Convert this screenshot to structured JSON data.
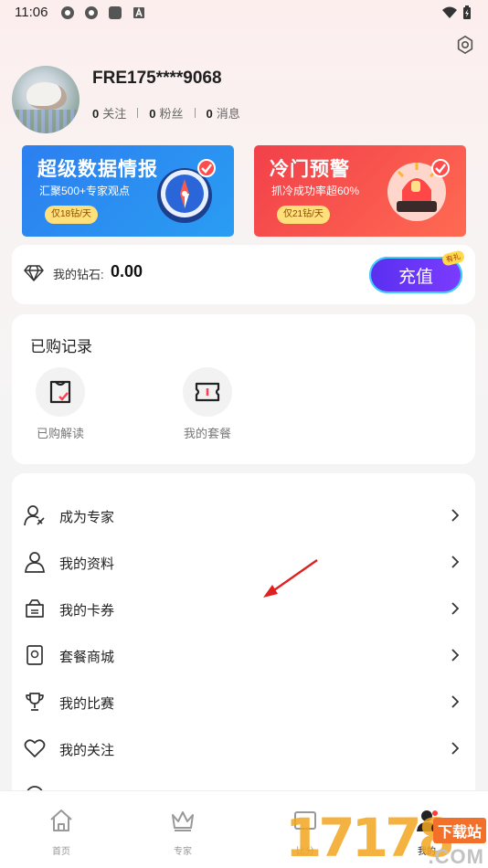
{
  "status_bar": {
    "time": "11:06"
  },
  "profile": {
    "username": "FRE175****9068",
    "stats": [
      {
        "count": "0",
        "label": "关注"
      },
      {
        "count": "0",
        "label": "粉丝"
      },
      {
        "count": "0",
        "label": "消息"
      }
    ]
  },
  "banners": [
    {
      "title": "超级数据情报",
      "subtitle": "汇聚500+专家观点",
      "pill": "仅18钻/天"
    },
    {
      "title": "冷门预警",
      "subtitle": "抓冷成功率超60%",
      "pill": "仅21钻/天"
    }
  ],
  "wallet": {
    "label": "我的钻石:",
    "value": "0.00",
    "recharge_label": "充值",
    "recharge_badge": "有礼"
  },
  "records": {
    "title": "已购记录",
    "items": [
      {
        "label": "已购解读",
        "icon": "receipt-check-icon"
      },
      {
        "label": "我的套餐",
        "icon": "ticket-icon"
      }
    ]
  },
  "menu": [
    {
      "label": "成为专家",
      "icon": "user-edit-icon"
    },
    {
      "label": "我的资料",
      "icon": "user-icon"
    },
    {
      "label": "我的卡券",
      "icon": "wallet-card-icon"
    },
    {
      "label": "套餐商城",
      "icon": "store-icon"
    },
    {
      "label": "我的比赛",
      "icon": "trophy-icon"
    },
    {
      "label": "我的关注",
      "icon": "heart-icon"
    }
  ],
  "tabs": [
    {
      "label": "首页",
      "icon": "home-icon"
    },
    {
      "label": "专家",
      "icon": "crown-icon"
    },
    {
      "label": "比分",
      "icon": "scoreboard-icon"
    },
    {
      "label": "我的",
      "icon": "profile-icon"
    }
  ],
  "watermark": {
    "number": "17178",
    "site": "下载站",
    "domain": ".COM"
  },
  "colors": {
    "accent_purple": "#6a35f7",
    "banner_blue": "#2c86f1",
    "banner_red": "#f4464d"
  }
}
